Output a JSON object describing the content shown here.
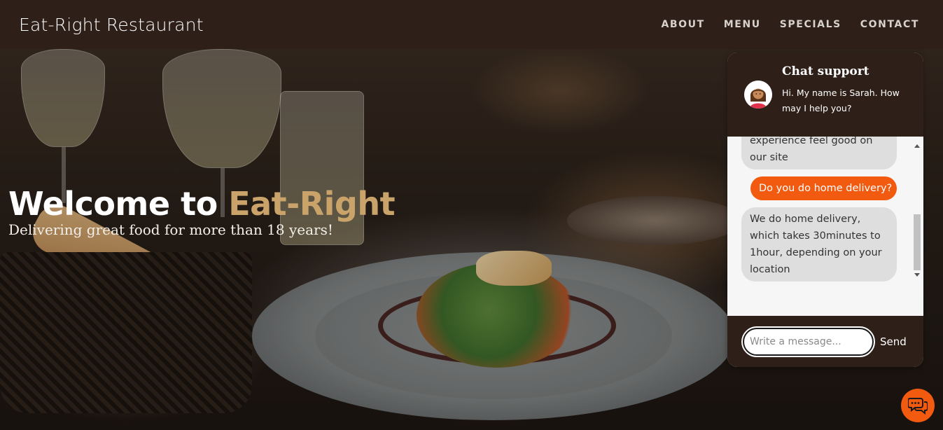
{
  "navbar": {
    "brand": "Eat-Right Restaurant",
    "links": [
      "ABOUT",
      "MENU",
      "SPECIALS",
      "CONTACT"
    ]
  },
  "hero": {
    "title_prefix": "Welcome to ",
    "title_accent": "Eat-Right",
    "subtitle": "Delivering great food for more than 18 years!"
  },
  "chat": {
    "title": "Chat support",
    "intro": "Hi. My name is Sarah. How may I help you?",
    "messages": [
      {
        "from": "bot",
        "text": "experience feel good on our site"
      },
      {
        "from": "user",
        "text": "Do you do home delivery?"
      },
      {
        "from": "bot",
        "text": "We do home delivery, which takes 30minutes to 1hour, depending on your location"
      }
    ],
    "input_placeholder": "Write a message...",
    "send_label": "Send"
  },
  "colors": {
    "nav_bg": "#2e1f18",
    "accent_gold": "#c9a36a",
    "accent_orange": "#f25a10",
    "bot_bubble": "#dedede"
  },
  "icons": {
    "avatar": "support-agent-avatar",
    "fab": "chat-bubbles-icon"
  }
}
